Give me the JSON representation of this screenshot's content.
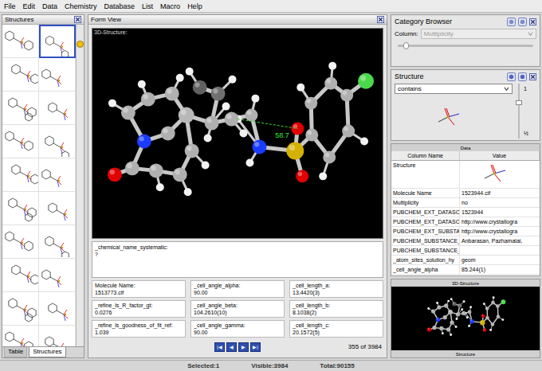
{
  "menu": [
    "File",
    "Edit",
    "Data",
    "Chemistry",
    "Database",
    "List",
    "Macro",
    "Help"
  ],
  "structures_panel": {
    "title": "Structures",
    "scroll_level": 0.05,
    "items": [
      {
        "selected": false
      },
      {
        "selected": true
      },
      {
        "selected": false
      },
      {
        "selected": false
      },
      {
        "selected": false
      },
      {
        "selected": false
      },
      {
        "selected": false
      },
      {
        "selected": false
      },
      {
        "selected": false
      },
      {
        "selected": false
      },
      {
        "selected": false
      },
      {
        "selected": false
      },
      {
        "selected": false
      },
      {
        "selected": false
      },
      {
        "selected": false
      },
      {
        "selected": false
      },
      {
        "selected": false
      },
      {
        "selected": false
      },
      {
        "selected": false
      },
      {
        "selected": false
      }
    ],
    "tabs": [
      {
        "label": "Table",
        "selected": false
      },
      {
        "label": "Structures",
        "selected": true
      }
    ]
  },
  "form_view": {
    "title": "Form View",
    "structure_label": "3D-Structure:",
    "distance_label": "58.7",
    "name_field": {
      "label": "_chemical_name_systematic:",
      "value": "?"
    },
    "fields": [
      {
        "label": "Molecule Name:",
        "value": "1513773.cif"
      },
      {
        "label": "_cell_angle_alpha:",
        "value": "90.00"
      },
      {
        "label": "_cell_length_a:",
        "value": "13.4420(3)"
      },
      {
        "label": "_refine_ls_R_factor_gt:",
        "value": "0.0276"
      },
      {
        "label": "_cell_angle_beta:",
        "value": "104.2610(10)"
      },
      {
        "label": "_cell_length_b:",
        "value": "8.1038(2)"
      },
      {
        "label": "_refine_ls_goodness_of_fit_ref:",
        "value": "1.039"
      },
      {
        "label": "_cell_angle_gamma:",
        "value": "90.00"
      },
      {
        "label": "_cell_length_c:",
        "value": "20.1572(5)"
      }
    ],
    "nav_buttons": [
      "|◀",
      "◀",
      "▶",
      "▶|"
    ],
    "record": "355 of 3984"
  },
  "category_browser": {
    "title": "Category Browser",
    "column_label": "Column:",
    "column_value": "Multiplicity",
    "column_disabled": true,
    "slider_level": 0.04
  },
  "structure_filter": {
    "title": "Structure",
    "mode": "contains",
    "count": "1",
    "fraction": "½",
    "slider_level": 0.3
  },
  "data_panel": {
    "title": "Data",
    "columns": [
      "Column Name",
      "Value"
    ],
    "rows": [
      {
        "name": "Structure",
        "kind": "structure",
        "value": ""
      },
      {
        "name": "Molecule Name",
        "kind": "text",
        "value": "1523944.cif"
      },
      {
        "name": "Multiplicity",
        "kind": "text",
        "value": "no"
      },
      {
        "name": "PUBCHEM_EXT_DATASO",
        "kind": "text",
        "value": "1523944"
      },
      {
        "name": "PUBCHEM_EXT_DATASO",
        "kind": "text",
        "value": "http://www.crystallogra"
      },
      {
        "name": "PUBCHEM_EXT_SUBSTA",
        "kind": "text",
        "value": "http://www.crystallogra"
      },
      {
        "name": "PUBCHEM_SUBSTANCE_",
        "kind": "text",
        "value": "Anbarasan, Pazhamalai,"
      },
      {
        "name": "PUBCHEM_SUBSTANCE_",
        "kind": "text",
        "value": ""
      },
      {
        "name": "_atom_sites_solution_hy",
        "kind": "text",
        "value": "geom"
      },
      {
        "name": "_cell_angle_alpha",
        "kind": "text",
        "value": "85.244(1)"
      }
    ]
  },
  "structure_3d_panel": {
    "title": "3D-Structure",
    "caption": "Structure"
  },
  "status_bar": {
    "selected": "Selected:1",
    "visible": "Visible:3984",
    "total": "Total:90155"
  }
}
